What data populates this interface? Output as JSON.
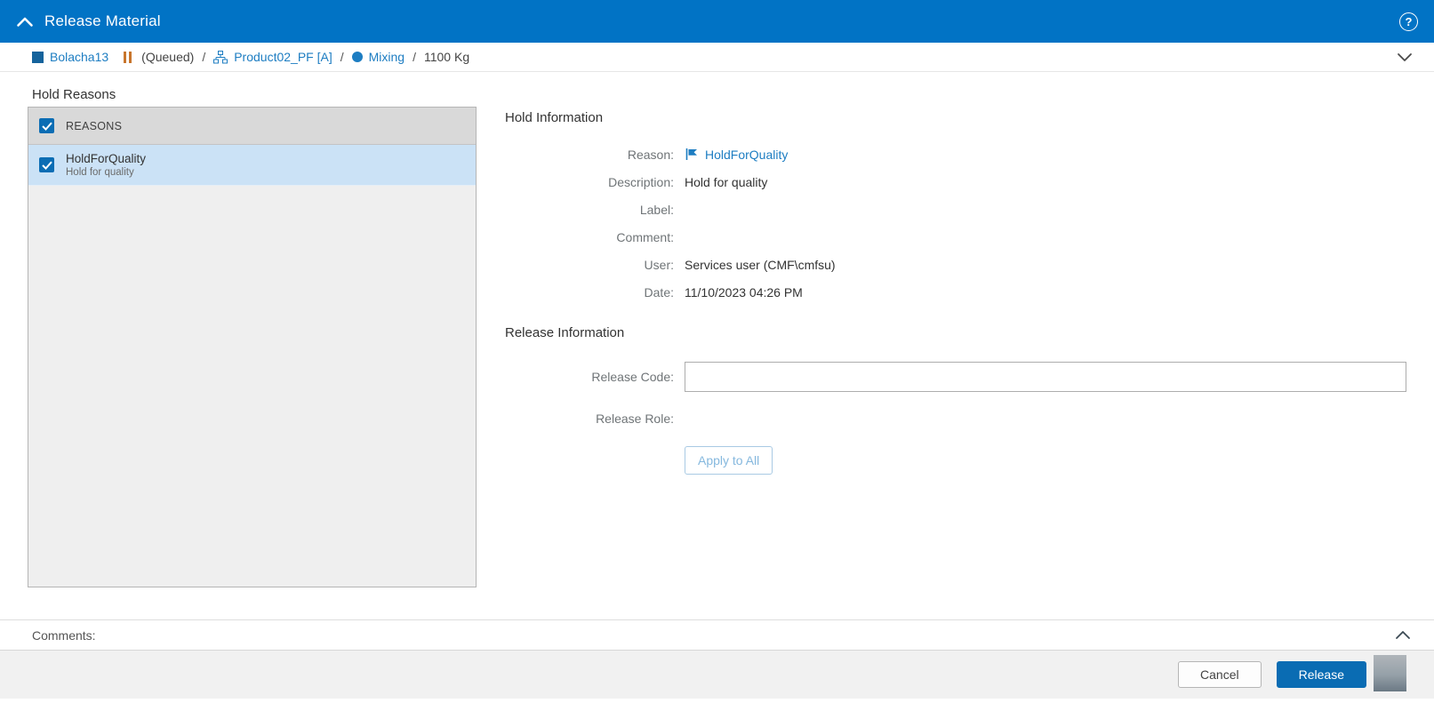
{
  "header": {
    "title": "Release Material",
    "help_label": "?"
  },
  "breadcrumb": {
    "material": "Bolacha13",
    "state": "(Queued)",
    "separator": "/",
    "product": "Product02_PF [A]",
    "step": "Mixing",
    "quantity": "1100 Kg"
  },
  "hold_reasons": {
    "title": "Hold Reasons",
    "column_header": "REASONS",
    "rows": [
      {
        "name": "HoldForQuality",
        "description": "Hold for quality"
      }
    ]
  },
  "hold_information": {
    "title": "Hold Information",
    "fields": [
      {
        "label": "Reason:",
        "value": "HoldForQuality"
      },
      {
        "label": "Description:",
        "value": "Hold for quality"
      },
      {
        "label": "Label:",
        "value": ""
      },
      {
        "label": "Comment:",
        "value": ""
      },
      {
        "label": "User:",
        "value": "Services user (CMF\\cmfsu)"
      },
      {
        "label": "Date:",
        "value": "11/10/2023 04:26 PM"
      }
    ]
  },
  "release_information": {
    "title": "Release Information",
    "release_code_label": "Release Code:",
    "release_code_value": "",
    "release_role_label": "Release Role:",
    "apply_to_all_label": "Apply to All"
  },
  "comments": {
    "label": "Comments:"
  },
  "footer": {
    "cancel_label": "Cancel",
    "release_label": "Release"
  },
  "colors": {
    "topbar_blue": "#0173c5",
    "link_blue": "#1d7dc2",
    "checkbox_blue": "#0b6db4",
    "selected_row": "#cbe2f6",
    "table_header_gray": "#d9d9d9",
    "release_button_blue": "#0a6cb3",
    "pause_orange": "#c8752c"
  }
}
